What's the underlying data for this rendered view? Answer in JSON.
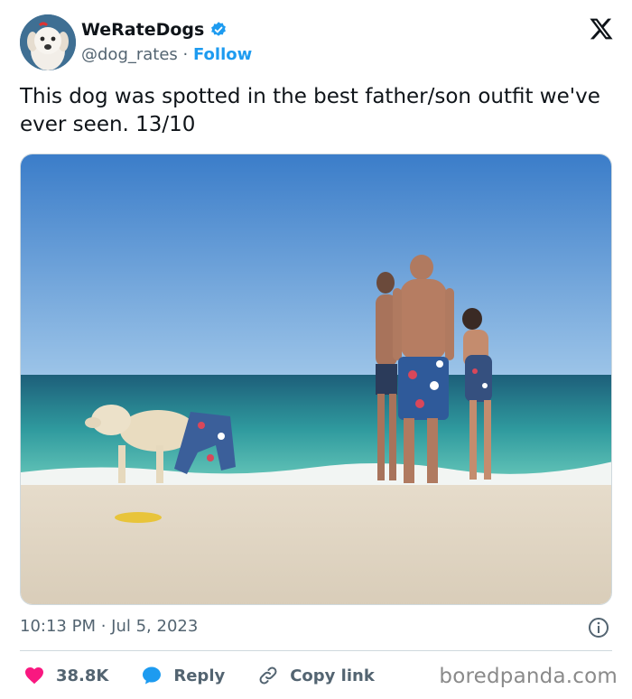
{
  "account": {
    "display_name": "WeRateDogs",
    "handle": "@dog_rates",
    "separator": " · ",
    "follow_label": "Follow",
    "verified": true
  },
  "tweet": {
    "text": "This dog was spotted in the best father/son outfit we've ever seen. 13/10",
    "time": "10:13 PM",
    "date_separator": " · ",
    "date": "Jul 5, 2023"
  },
  "actions": {
    "likes": "38.8K",
    "reply_label": "Reply",
    "copy_link_label": "Copy link"
  },
  "watermark": "boredpanda.com",
  "icons": {
    "verified": "verified-badge-icon",
    "platform": "x-logo-icon",
    "info": "info-icon",
    "like": "heart-icon",
    "reply": "speech-bubble-icon",
    "copy_link": "link-icon"
  },
  "colors": {
    "accent": "#1d9bf0",
    "like": "#f91880",
    "text": "#0f1419",
    "muted": "#536471"
  }
}
